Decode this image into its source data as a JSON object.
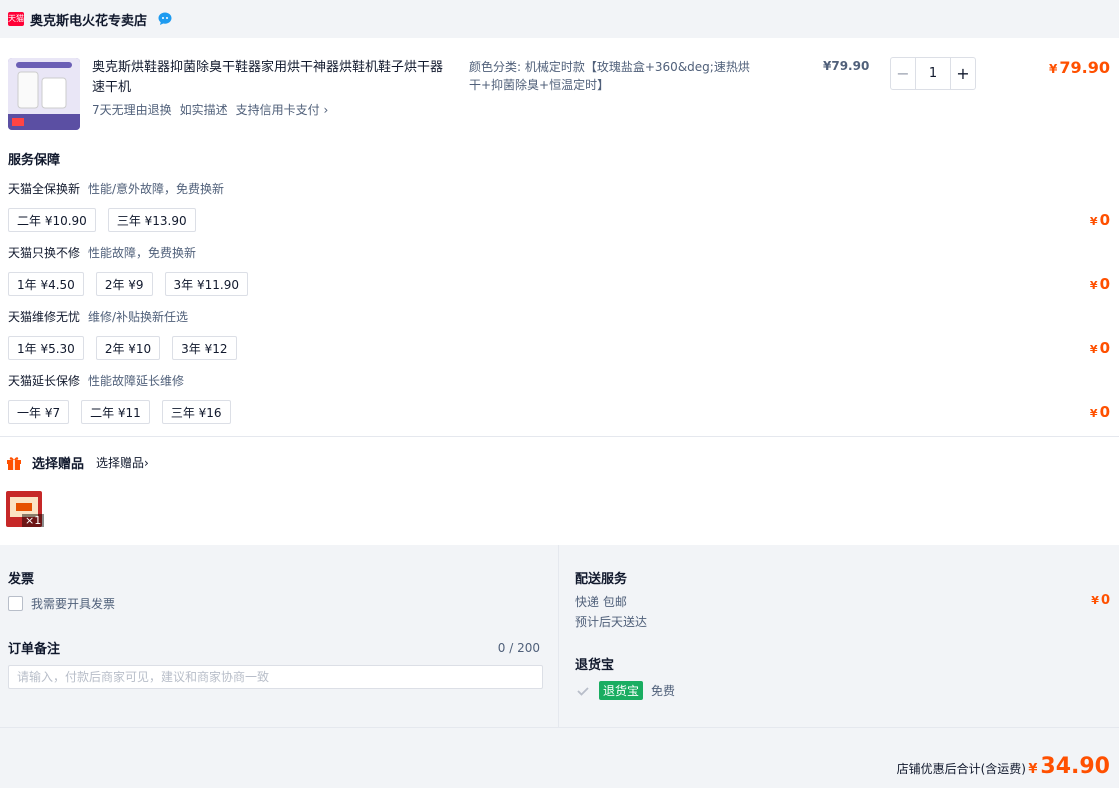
{
  "store": {
    "badge": "天猫",
    "name": "奥克斯电火花专卖店"
  },
  "product": {
    "title": "奥克斯烘鞋器抑菌除臭干鞋器家用烘干神器烘鞋机鞋子烘干器速干机",
    "tags": [
      "7天无理由退换",
      "如实描述",
      "支持信用卡支付 ›"
    ],
    "sku": "颜色分类: 机械定时款【玫瑰盐盒+360&deg;速热烘干+抑菌除臭+恒温定时】",
    "unit_price": "¥79.90",
    "quantity": "1",
    "minus": "−",
    "plus": "+",
    "total_yen": "¥",
    "total_value": "79.90"
  },
  "services": {
    "title": "服务保障",
    "groups": [
      {
        "name": "天猫全保换新",
        "desc": "性能/意外故障，免费换新",
        "options": [
          "二年 ¥10.90",
          "三年 ¥13.90"
        ],
        "yen": "¥",
        "price": "0"
      },
      {
        "name": "天猫只换不修",
        "desc": "性能故障，免费换新",
        "options": [
          "1年 ¥4.50",
          "2年 ¥9",
          "3年 ¥11.90"
        ],
        "yen": "¥",
        "price": "0"
      },
      {
        "name": "天猫维修无忧",
        "desc": "维修/补贴换新任选",
        "options": [
          "1年 ¥5.30",
          "2年 ¥10",
          "3年 ¥12"
        ],
        "yen": "¥",
        "price": "0"
      },
      {
        "name": "天猫延长保修",
        "desc": "性能故障延长维修",
        "options": [
          "一年 ¥7",
          "二年 ¥11",
          "三年 ¥16"
        ],
        "yen": "¥",
        "price": "0"
      }
    ]
  },
  "gift": {
    "title": "选择赠品",
    "link": "选择赠品›",
    "count": "×1"
  },
  "invoice": {
    "title": "发票",
    "checkbox_label": "我需要开具发票"
  },
  "note": {
    "title": "订单备注",
    "count": "0 / 200",
    "placeholder": "请输入，付款后商家可见，建议和商家协商一致"
  },
  "delivery": {
    "title": "配送服务",
    "method": "快递 包邮",
    "eta": "预计后天送达",
    "yen": "¥",
    "price": "0"
  },
  "return_service": {
    "title": "退货宝",
    "badge": "退货宝",
    "fee": "免费"
  },
  "footer": {
    "label": "店铺优惠后合计(含运费)",
    "yen": "¥",
    "total": "34.90"
  },
  "colors": {
    "accent": "#ff5000",
    "tmall_red": "#ff0036",
    "return_green": "#1aad61"
  }
}
